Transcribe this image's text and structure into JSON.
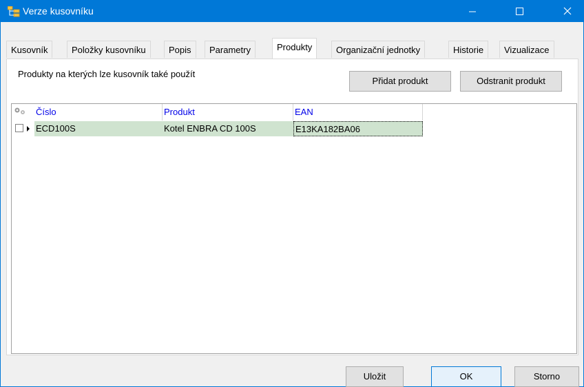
{
  "window": {
    "title": "Verze kusovníku",
    "accent": "#0078d7"
  },
  "tabs": [
    {
      "label": "Kusovník"
    },
    {
      "label": "Položky kusovníku"
    },
    {
      "label": "Popis"
    },
    {
      "label": "Parametry"
    },
    {
      "label": "Produkty"
    },
    {
      "label": "Organizační jednotky"
    },
    {
      "label": "Historie"
    },
    {
      "label": "Vizualizace"
    }
  ],
  "active_tab": "Produkty",
  "panel": {
    "description": "Produkty na kterých lze kusovník také použít",
    "add_button": "Přidat produkt",
    "remove_button": "Odstranit produkt"
  },
  "grid": {
    "columns": [
      "Číslo",
      "Produkt",
      "EAN"
    ],
    "rows": [
      {
        "cislo": "ECD100S",
        "produkt": "Kotel ENBRA CD 100S",
        "ean": "E13KA182BA06"
      }
    ],
    "header_color": "#0000e8",
    "row_color": "#cfe3cf"
  },
  "footer": {
    "save_label": "Uložit",
    "ok_label": "OK",
    "cancel_label": "Storno"
  }
}
